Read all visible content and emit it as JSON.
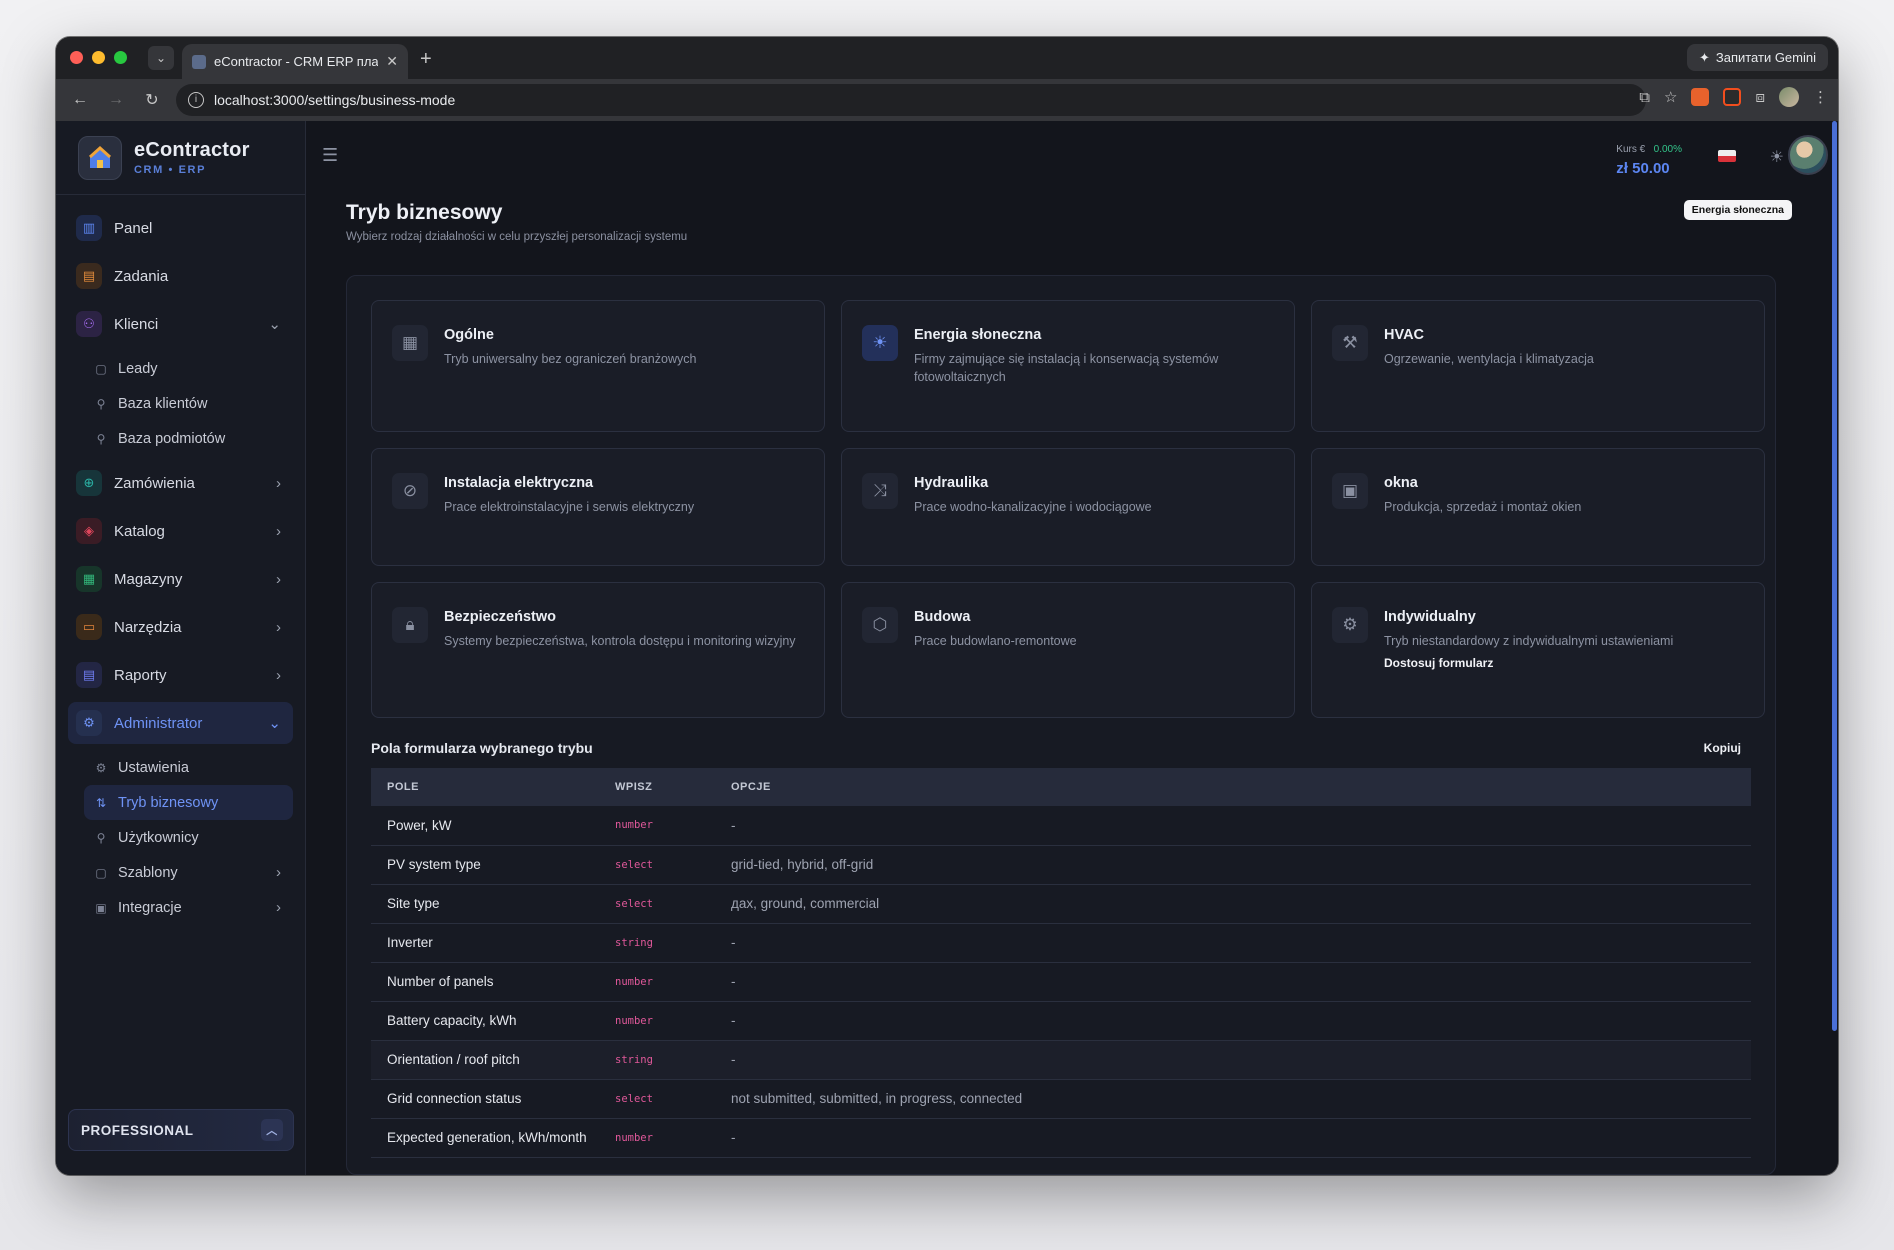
{
  "browser": {
    "tab_title": "eContractor - CRM ERP плат…",
    "tab_close": "✕",
    "new_tab": "+",
    "url": "localhost:3000/settings/business-mode",
    "gemini_label": "Запитати Gemini"
  },
  "brand": {
    "name": "eContractor",
    "subtitle": "CRM • ERP"
  },
  "sidebar": {
    "items": [
      {
        "label": "Panel",
        "icon": "chart-icon",
        "color": "#5d86f0"
      },
      {
        "label": "Zadania",
        "icon": "clipboard-icon",
        "color": "#e08a3b"
      },
      {
        "label": "Klienci",
        "icon": "users-icon",
        "color": "#a66cf0",
        "expanded": true,
        "children": [
          "Leady",
          "Baza klientów",
          "Baza podmiotów"
        ]
      },
      {
        "label": "Zamówienia",
        "icon": "orders-icon",
        "color": "#2bb3a6"
      },
      {
        "label": "Katalog",
        "icon": "catalog-icon",
        "color": "#e0465c"
      },
      {
        "label": "Magazyny",
        "icon": "warehouse-icon",
        "color": "#32b67a"
      },
      {
        "label": "Narzędzia",
        "icon": "tools-icon",
        "color": "#e0843b"
      },
      {
        "label": "Raporty",
        "icon": "report-icon",
        "color": "#6f7cf0"
      },
      {
        "label": "Administrator",
        "icon": "admin-icon",
        "color": "#6f93f5",
        "expanded": true,
        "active": true,
        "children": [
          "Ustawienia",
          "Tryb biznesowy",
          "Użytkownicy",
          "Szablony",
          "Integracje"
        ]
      }
    ],
    "active_child": "Tryb biznesowy"
  },
  "plan": {
    "label": "PROFESSIONAL"
  },
  "topbar": {
    "rate_label": "Kurs €",
    "rate_change": "0.00%",
    "rate_value": "zł 50.00",
    "tooltip": "Energia słoneczna"
  },
  "page": {
    "title": "Tryb biznesowy",
    "subtitle": "Wybierz rodzaj działalności w celu przyszłej personalizacji systemu"
  },
  "modes": [
    {
      "title": "Ogólne",
      "desc": "Tryb uniwersalny bez ograniczeń branżowych",
      "icon": "grid-icon"
    },
    {
      "title": "Energia słoneczna",
      "desc": "Firmy zajmujące się instalacją i konserwacją systemów fotowoltaicznych",
      "icon": "sun-icon",
      "selected": true
    },
    {
      "title": "HVAC",
      "desc": "Ogrzewanie, wentylacja i klimatyzacja",
      "icon": "wrench-icon"
    },
    {
      "title": "Instalacja elektryczna",
      "desc": "Prace elektroinstalacyjne i serwis elektryczny",
      "icon": "eye-off-icon"
    },
    {
      "title": "Hydraulika",
      "desc": "Prace wodno-kanalizacyjne i wodociągowe",
      "icon": "shuffle-icon"
    },
    {
      "title": "okna",
      "desc": "Produkcja, sprzedaż i montaż okien",
      "icon": "image-icon"
    },
    {
      "title": "Bezpieczeństwo",
      "desc": "Systemy bezpieczeństwa, kontrola dostępu i monitoring wizyjny",
      "icon": "lock-icon"
    },
    {
      "title": "Budowa",
      "desc": "Prace budowlano-remontowe",
      "icon": "box-icon"
    },
    {
      "title": "Indywidualny",
      "desc": "Tryb niestandardowy z indywidualnymi ustawieniami",
      "icon": "gear-icon",
      "link": "Dostosuj formularz"
    }
  ],
  "fields": {
    "title": "Pola formularza wybranego trybu",
    "copy_label": "Kopiuj",
    "columns": [
      "POLE",
      "WPISZ",
      "OPCJE"
    ],
    "rows": [
      {
        "field": "Power, kW",
        "type": "number",
        "options": "-"
      },
      {
        "field": "PV system type",
        "type": "select",
        "options": "grid-tied, hybrid, off-grid"
      },
      {
        "field": "Site type",
        "type": "select",
        "options": "дах, ground, commercial"
      },
      {
        "field": "Inverter",
        "type": "string",
        "options": "-"
      },
      {
        "field": "Number of panels",
        "type": "number",
        "options": "-"
      },
      {
        "field": "Battery capacity, kWh",
        "type": "number",
        "options": "-"
      },
      {
        "field": "Orientation / roof pitch",
        "type": "string",
        "options": "-"
      },
      {
        "field": "Grid connection status",
        "type": "select",
        "options": "not submitted, submitted, in progress, connected"
      },
      {
        "field": "Expected generation, kWh/month",
        "type": "number",
        "options": "-"
      }
    ]
  }
}
